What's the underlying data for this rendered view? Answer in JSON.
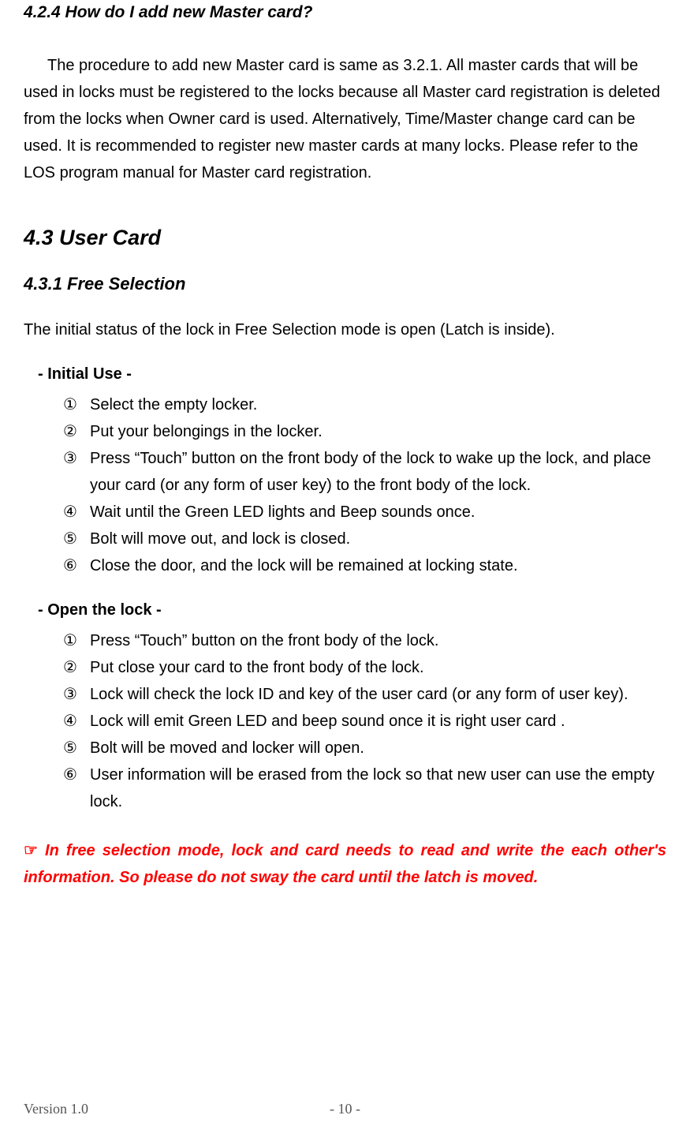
{
  "section_424": {
    "heading": "4.2.4    How do I add new Master card?",
    "paragraph": "The procedure to add new Master card is same as 3.2.1. All master cards that will be used in locks must be registered to the locks because all Master card registration is deleted from the locks when Owner card is used.\nAlternatively, Time/Master change card can be used. It is recommended to register new master cards at many locks. Please refer to the LOS program manual for Master card registration."
  },
  "section_43": {
    "heading": "4.3    User Card"
  },
  "section_431": {
    "heading": "4.3.1    Free Selection",
    "intro": "The initial status of the lock in Free Selection mode is open (Latch is inside).",
    "initial_use": {
      "heading": "- Initial Use -",
      "items": [
        "Select the empty locker.",
        "Put your belongings in the locker.",
        "Press “Touch” button on the front body of the lock to wake up the lock, and place your card (or any form of user key) to the front body of the lock.",
        "Wait until the Green LED lights and Beep sounds once.",
        "Bolt will move out, and lock is closed.",
        "Close the door, and the lock will be remained at locking state."
      ]
    },
    "open_lock": {
      "heading": "- Open the lock -",
      "items": [
        "Press “Touch” button on the front body of the lock.",
        "Put close your card to the front body of the lock.",
        "Lock will check the lock ID and key of the user card (or any form of user key).",
        "Lock will emit Green LED and beep sound once it is right user card .",
        "Bolt will be moved and locker will open.",
        "User information will be erased from the lock so that new user can use the empty lock."
      ]
    },
    "note": "In free selection mode, lock and card needs to read and write the each other's information. So please do not sway the card until the latch is moved."
  },
  "markers": [
    "①",
    "②",
    "③",
    "④",
    "⑤",
    "⑥"
  ],
  "pointer": "☞",
  "footer": {
    "version": "Version 1.0",
    "page": "- 10 -"
  }
}
